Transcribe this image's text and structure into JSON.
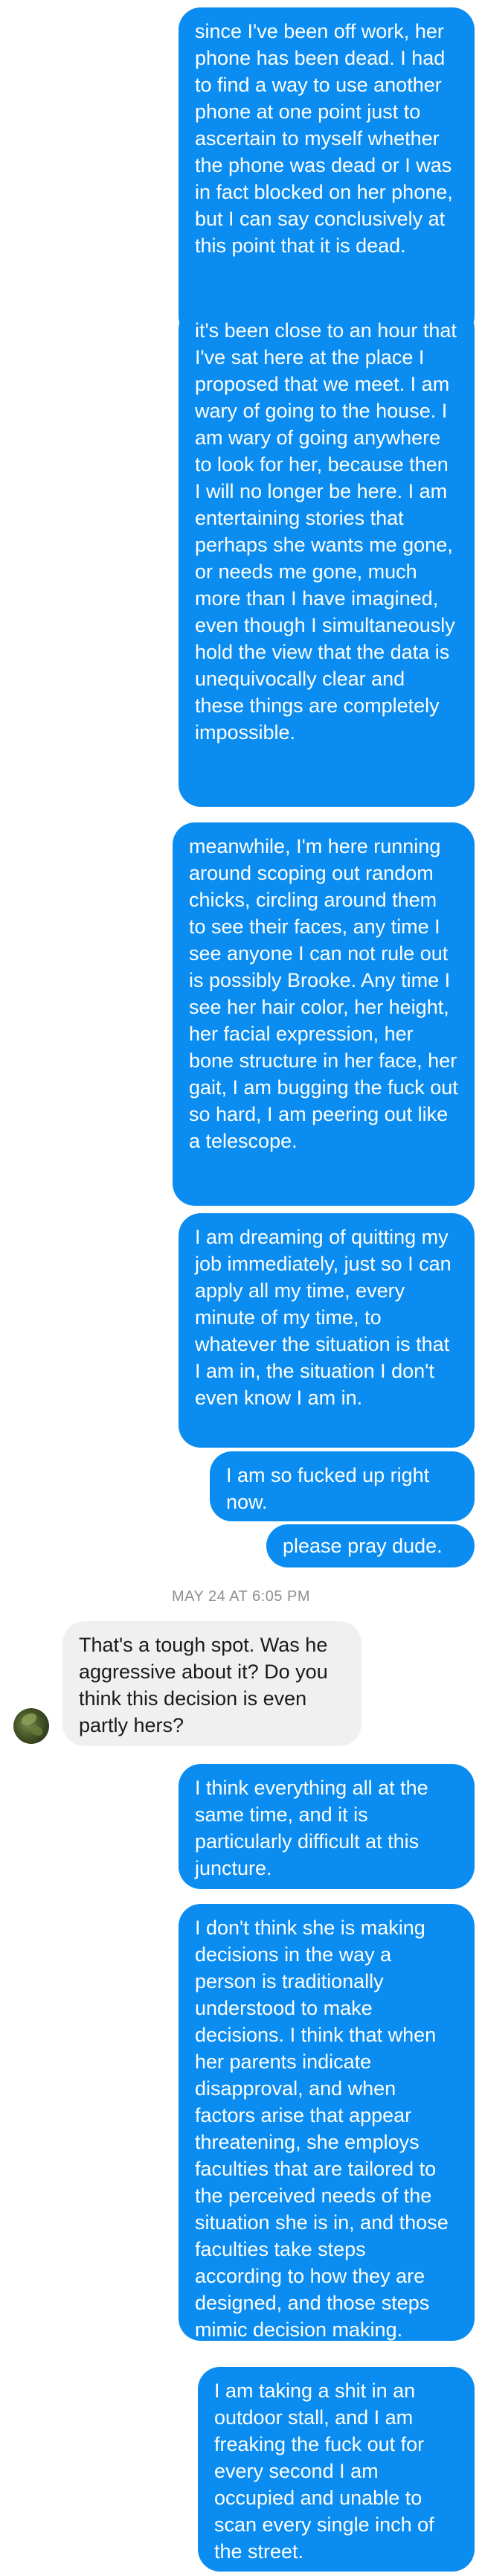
{
  "conversation": {
    "messages_before": [
      {
        "text": "since I've been off work, her phone has been dead. I had to find a way to use another phone at one point just to ascertain to myself whether the phone was dead or I was in fact blocked on her phone, but I can say conclusively at this point that it is dead."
      },
      {
        "text": "it's been close to an hour that I've sat here at the place I proposed that we meet. I am wary of going to the house. I am wary of going anywhere to look for her, because then I will no longer be here. I am entertaining stories that perhaps she wants me gone, or needs me gone, much more than I have imagined, even though I simultaneously hold the view that the data is unequivocally clear and these things are completely impossible."
      },
      {
        "text": "meanwhile, I'm here running around scoping out random chicks, circling around them to see their faces, any time I see anyone I can not rule out is possibly Brooke. Any time I see her hair color, her height, her facial expression, her bone structure in her face, her gait, I am bugging the fuck out so hard, I am peering out like a telescope."
      },
      {
        "text": "I am dreaming of quitting my job immediately, just so I can apply all my time, every minute of my time, to whatever the situation is that I am in, the situation I don't even know I am in."
      },
      {
        "text": "I am so fucked up right now."
      },
      {
        "text": "please pray dude."
      }
    ],
    "timestamp": "MAY 24 AT 6:05 PM",
    "incoming": {
      "text": "That's a tough spot. Was he aggressive about it? Do you think this decision is even partly hers?",
      "avatar_icon": "profile-photo-icon"
    },
    "messages_after": [
      {
        "text": "I think everything all at the same time, and it is particularly difficult at this juncture."
      },
      {
        "text": "I don't think she is making decisions in the way a person is traditionally understood to make decisions. I think that when her parents indicate disapproval, and when factors arise that appear threatening, she employs faculties that are tailored to the perceived needs of the situation she is in, and those faculties take steps according to how they are designed, and those steps mimic decision making."
      },
      {
        "text": "I am taking a shit in an outdoor stall, and I am freaking the fuck out for every second I am occupied and unable to scan every single inch of the street."
      }
    ]
  },
  "colors": {
    "outgoing_bubble": "#0a8cf0",
    "incoming_bubble": "#f0f0f0",
    "timestamp_text": "#8e8e93"
  }
}
